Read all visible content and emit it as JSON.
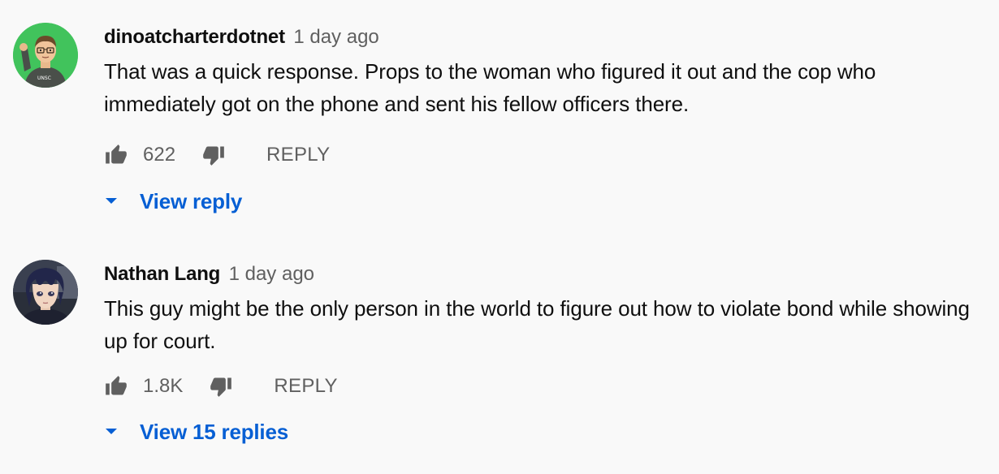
{
  "comments": [
    {
      "author": "dinoatcharterdotnet",
      "timestamp": "1 day ago",
      "text": "That was a quick response. Props to the woman who figured it out and the cop who immediately got on the phone and sent his fellow officers there.",
      "like_count": "622",
      "reply_label": "REPLY",
      "view_replies_label": "View reply"
    },
    {
      "author": "Nathan Lang",
      "timestamp": "1 day ago",
      "text": "This guy might be the only person in the world to figure out how to violate bond while showing up for court.",
      "like_count": "1.8K",
      "reply_label": "REPLY",
      "view_replies_label": "View 15 replies"
    }
  ],
  "colors": {
    "background": "#f9f9f9",
    "link_blue": "#065fd4",
    "secondary_text": "#606060",
    "primary_text": "#0f0f0f"
  },
  "icons": [
    "thumb-up-icon",
    "thumb-down-icon",
    "caret-down-icon",
    "avatar-xbox-character",
    "avatar-anime-character"
  ]
}
